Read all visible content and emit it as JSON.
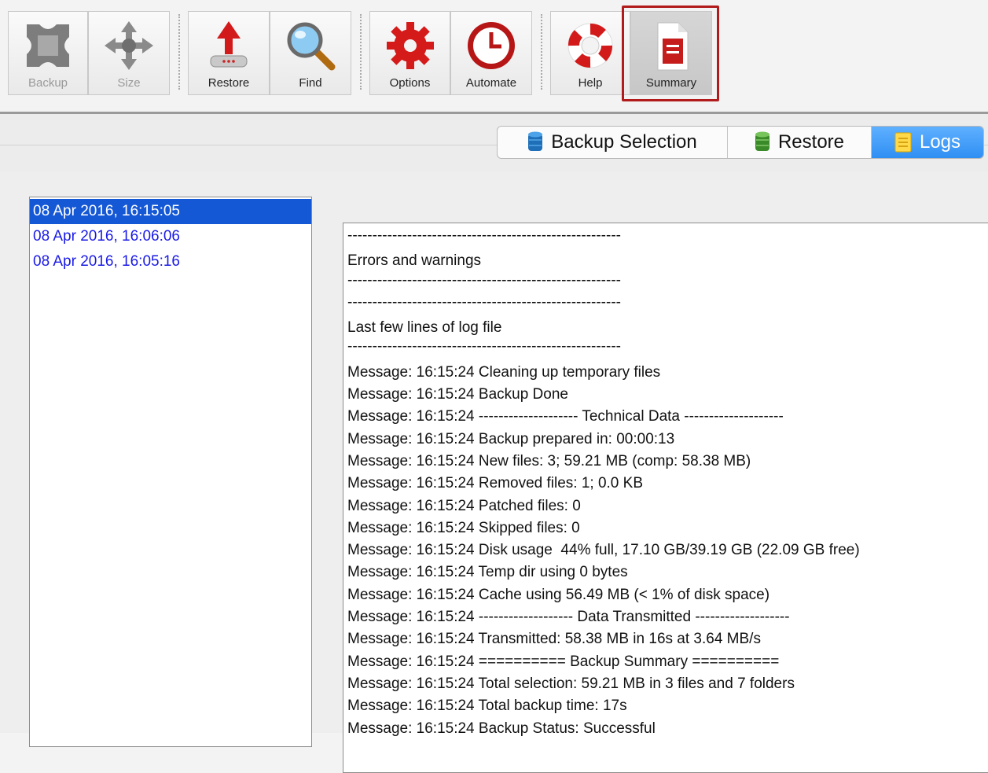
{
  "toolbar": {
    "buttons": [
      {
        "label": "Backup",
        "icon": "backup-icon",
        "enabled": false
      },
      {
        "label": "Size",
        "icon": "size-arrows-icon",
        "enabled": false
      },
      {
        "label": "Restore",
        "icon": "restore-upload-icon",
        "enabled": true
      },
      {
        "label": "Find",
        "icon": "magnifier-icon",
        "enabled": true
      },
      {
        "label": "Options",
        "icon": "gear-icon",
        "enabled": true
      },
      {
        "label": "Automate",
        "icon": "clock-icon",
        "enabled": true
      },
      {
        "label": "Help",
        "icon": "lifebuoy-icon",
        "enabled": true
      },
      {
        "label": "Summary",
        "icon": "document-icon",
        "enabled": true,
        "selected": true
      }
    ]
  },
  "tabs": [
    {
      "label": "Backup Selection",
      "icon": "database-blue-icon",
      "active": false
    },
    {
      "label": "Restore",
      "icon": "database-green-icon",
      "active": false
    },
    {
      "label": "Logs",
      "icon": "notepad-icon",
      "active": true
    }
  ],
  "log_list": [
    {
      "label": "08 Apr 2016, 16:15:05",
      "selected": true
    },
    {
      "label": "08 Apr 2016, 16:06:06",
      "selected": false
    },
    {
      "label": "08 Apr 2016, 16:05:16",
      "selected": false
    }
  ],
  "log_lines": [
    "-------------------------------------------------------",
    "Errors and warnings",
    "-------------------------------------------------------",
    "-------------------------------------------------------",
    "Last few lines of log file",
    "-------------------------------------------------------",
    "Message: 16:15:24 Cleaning up temporary files",
    "Message: 16:15:24 Backup Done",
    "Message: 16:15:24 -------------------- Technical Data --------------------",
    "Message: 16:15:24 Backup prepared in: 00:00:13",
    "Message: 16:15:24 New files: 3; 59.21 MB (comp: 58.38 MB)",
    "Message: 16:15:24 Removed files: 1; 0.0 KB",
    "Message: 16:15:24 Patched files: 0",
    "Message: 16:15:24 Skipped files: 0",
    "Message: 16:15:24 Disk usage  44% full, 17.10 GB/39.19 GB (22.09 GB free)",
    "Message: 16:15:24 Temp dir using 0 bytes",
    "Message: 16:15:24 Cache using 56.49 MB (< 1% of disk space)",
    "Message: 16:15:24 ------------------- Data Transmitted -------------------",
    "Message: 16:15:24 Transmitted: 58.38 MB in 16s at 3.64 MB/s",
    "Message: 16:15:24 ========== Backup Summary ==========",
    "Message: 16:15:24 Total selection: 59.21 MB in 3 files and 7 folders",
    "Message: 16:15:24 Total backup time: 17s",
    "Message: 16:15:24 Backup Status: Successful"
  ]
}
